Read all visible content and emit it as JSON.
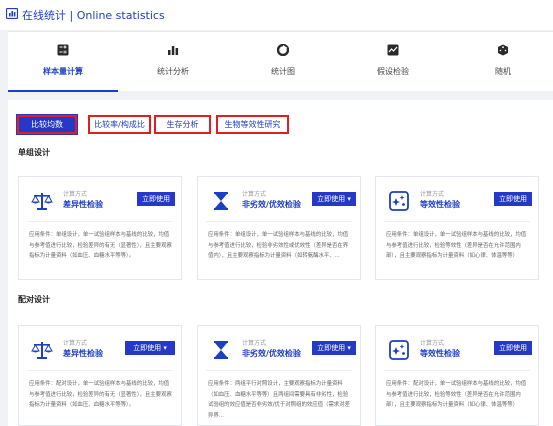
{
  "header": {
    "title": "在线统计 | Online statistics"
  },
  "nav": [
    {
      "label": "样本量计算",
      "icon": "calculator-icon",
      "active": true
    },
    {
      "label": "统计分析",
      "icon": "bar-chart-icon",
      "active": false
    },
    {
      "label": "统计图",
      "icon": "pie-chart-icon",
      "active": false
    },
    {
      "label": "假设检验",
      "icon": "hypothesis-icon",
      "active": false
    },
    {
      "label": "随机",
      "icon": "dice-icon",
      "active": false
    }
  ],
  "tabs": [
    {
      "label": "比较均数",
      "active": true
    },
    {
      "label": "比较率/构成比",
      "active": false
    },
    {
      "label": "生存分析",
      "active": false
    },
    {
      "label": "生物等效性研究",
      "active": false
    }
  ],
  "sections": [
    {
      "title": "单组设计",
      "cards": [
        {
          "type": "计算方式",
          "name": "差异性检验",
          "button": "立即使用",
          "icon": "balance-scale-icon",
          "desc": "应用条件：单组设计，单一试验组样本与基线的比较，均值与参考值进行比较，检验差异的有无（显著性），且主要观察指标为计量资料（如血压、血糖水平等等）。"
        },
        {
          "type": "计算方式",
          "name": "非劣效/优效检验",
          "button": "立即使用 ▾",
          "icon": "hourglass-icon",
          "desc": "应用条件：单组设计，单一试验组样本与基线的比较，均值与参考值进行比较，检验非劣效性或优效性（差异是否在界值内），且主要观察指标为计量资料（如转氨酶水平、..."
        },
        {
          "type": "计算方式",
          "name": "等效性检验",
          "button": "立即使用",
          "icon": "equivalence-icon",
          "desc": "应用条件：单组设计，单一试验组样本与基线的比较，均值与参考值进行比较，检验等效性（差异是否在允许范围内部），且主要观察指标为计量资料（如心律、体温等等）"
        }
      ]
    },
    {
      "title": "配对设计",
      "cards": [
        {
          "type": "计算方式",
          "name": "差异性检验",
          "button": "立即使用 ▾",
          "icon": "balance-scale-icon",
          "desc": "应用条件：配对设计，单一试验组样本与基线的比较，均值与参考值进行比较，检验差异的有无（显著性），且主要观察指标为计量资料（如血压、血糖水平等等）。"
        },
        {
          "type": "计算方式",
          "name": "非劣效/优效检验",
          "button": "立即使用 ▾",
          "icon": "hourglass-icon",
          "desc": "应用条件：两组平行对照设计，主要观察指标为计量资料（如血压、血糖水平等等）且两组间需要具有非劣性，检验试验组的效应值是否非劣效/优于对照组的效应值（需求对差异界..."
        },
        {
          "type": "计算方式",
          "name": "等效性检验",
          "button": "立即使用",
          "icon": "equivalence-icon",
          "desc": "应用条件：配对设计，单一试验组样本与基线的比较，均值与参考值进行比较，检验等效性（差异是否在允许范围内部），且主要观察指标为计量资料（如心律、体温等等）"
        }
      ]
    }
  ]
}
